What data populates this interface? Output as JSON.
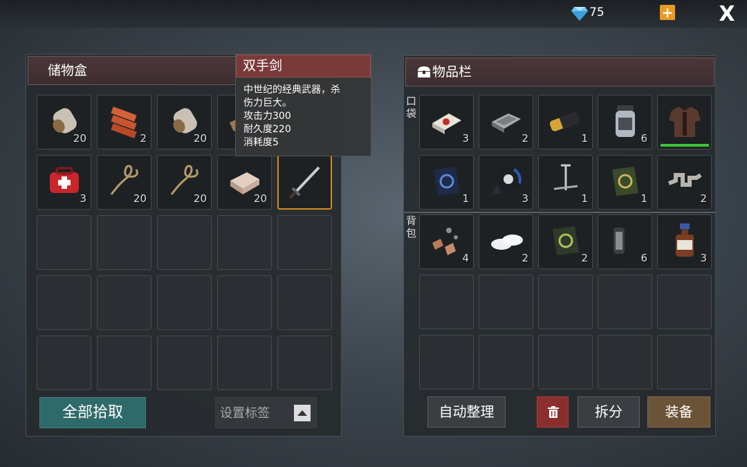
{
  "topbar": {
    "gem_count": "75",
    "add_label": "+",
    "close_label": "X"
  },
  "storage": {
    "title": "储物盒",
    "slots": [
      {
        "item": "canned-food-icon",
        "count": "20"
      },
      {
        "item": "bricks-icon",
        "count": "2"
      },
      {
        "item": "canned-food-icon",
        "count": "20"
      },
      {
        "item": "wood-plank-icon",
        "count": ""
      },
      {
        "item": "",
        "count": ""
      },
      {
        "item": "first-aid-bag-icon",
        "count": "3"
      },
      {
        "item": "rope-icon",
        "count": "20"
      },
      {
        "item": "rope-icon",
        "count": "20"
      },
      {
        "item": "stone-block-icon",
        "count": "20"
      },
      {
        "item": "two-handed-sword-icon",
        "count": ""
      }
    ],
    "pickall_label": "全部拾取",
    "tag_label": "设置标签"
  },
  "tooltip": {
    "title": "双手剑",
    "line1": "中世纪的经典武器，杀",
    "line2": "伤力巨大。",
    "line3": "攻击力300",
    "line4": "耐久度220",
    "line5": "消耗度5"
  },
  "inventory": {
    "title": "物品栏",
    "pocket_label_1": "口",
    "pocket_label_2": "袋",
    "bag_label_1": "背",
    "bag_label_2": "包",
    "pocket": [
      {
        "item": "cigarettes-icon",
        "count": "3"
      },
      {
        "item": "hard-drive-icon",
        "count": "2"
      },
      {
        "item": "battery-icon",
        "count": "1"
      },
      {
        "item": "jar-icon",
        "count": "6"
      },
      {
        "item": "leather-vest-icon",
        "count": ""
      },
      {
        "item": "blue-book-icon",
        "count": "1"
      },
      {
        "item": "duct-tape-icon",
        "count": "3"
      },
      {
        "item": "nails-icon",
        "count": "1"
      },
      {
        "item": "green-book-icon",
        "count": "1"
      },
      {
        "item": "crankshaft-icon",
        "count": "2"
      }
    ],
    "bag": [
      {
        "item": "scrap-parts-icon",
        "count": "4"
      },
      {
        "item": "pills-icon",
        "count": "2"
      },
      {
        "item": "recipe-book-icon",
        "count": "2"
      },
      {
        "item": "film-roll-icon",
        "count": "6"
      },
      {
        "item": "medicine-bottle-icon",
        "count": "3"
      }
    ],
    "sort_label": "自动整理",
    "split_label": "拆分",
    "equip_label": "装备"
  },
  "colors": {
    "selected_border": "#d48a1e",
    "durability": "#3ec23a",
    "header": "#4a3639"
  }
}
